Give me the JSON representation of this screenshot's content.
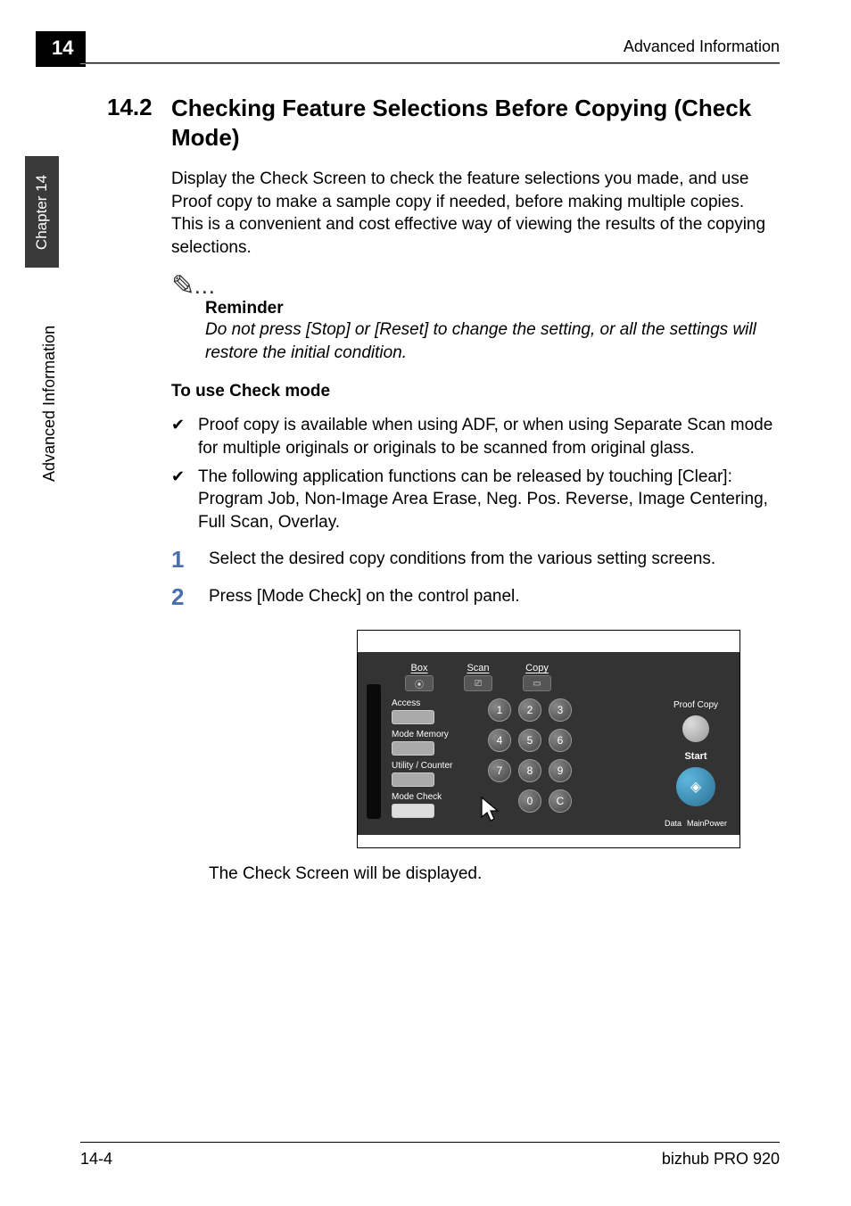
{
  "header": {
    "chapter_tab": "14",
    "title_right": "Advanced Information"
  },
  "sidebar": {
    "tab": "Chapter 14",
    "vertical": "Advanced Information"
  },
  "section": {
    "number": "14.2",
    "title": "Checking Feature Selections Before Copying (Check Mode)",
    "intro": "Display the Check Screen to check the feature selections you made, and use Proof copy to make a sample copy if needed, before making multiple copies. This is a convenient and cost effective way of viewing the results of the copying selections."
  },
  "reminder": {
    "label": "Reminder",
    "body": "Do not press [Stop] or [Reset] to change the setting, or all the settings will restore the initial condition."
  },
  "subheading": "To use Check mode",
  "checks": [
    "Proof copy is available when using ADF, or when using Separate Scan mode for multiple originals or originals to be scanned from original glass.",
    "The following application functions can be released by touching [Clear]: Program Job, Non-Image Area Erase, Neg. Pos. Reverse, Image Centering, Full Scan, Overlay."
  ],
  "steps": [
    {
      "num": "1",
      "text": "Select the desired copy conditions from the various setting screens."
    },
    {
      "num": "2",
      "text": "Press [Mode Check] on the control panel."
    }
  ],
  "panel": {
    "tabs": {
      "box": "Box",
      "scan": "Scan",
      "copy": "Copy"
    },
    "tab_icons": {
      "box": "⦿",
      "scan": "⎚",
      "copy": "▭"
    },
    "labels": {
      "access": "Access",
      "mode_memory": "Mode Memory",
      "utility_counter": "Utility / Counter",
      "mode_check": "Mode Check",
      "proof": "Proof Copy",
      "start": "Start",
      "data": "Data",
      "main_power": "MainPower"
    },
    "keypad": [
      "1",
      "2",
      "3",
      "4",
      "5",
      "6",
      "7",
      "8",
      "9",
      "",
      "0",
      "C"
    ],
    "start_glyph": "◈"
  },
  "result": "The Check Screen will be displayed.",
  "footer": {
    "left": "14-4",
    "right": "bizhub PRO 920"
  }
}
